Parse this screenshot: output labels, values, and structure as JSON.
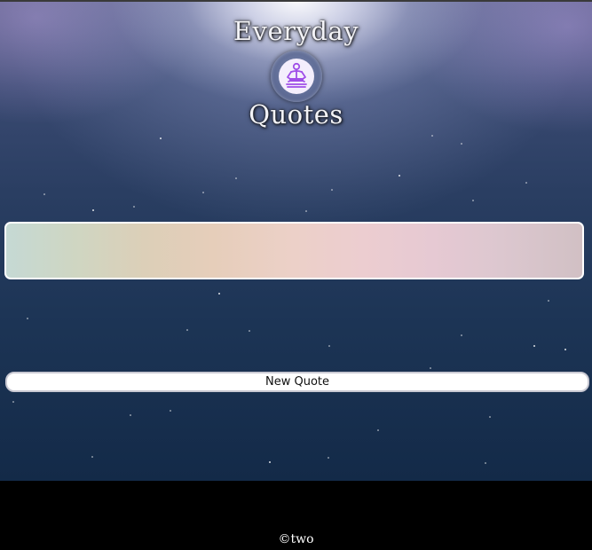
{
  "header": {
    "title_top": "Everyday",
    "title_bottom": "Quotes",
    "logo_icon": "meditation-icon"
  },
  "quote": {
    "text": ""
  },
  "actions": {
    "new_quote_label": "New Quote"
  },
  "footer": {
    "copyright": "©two"
  },
  "colors": {
    "logo_accent": "#a04ee8",
    "footer_background": "#000000"
  }
}
